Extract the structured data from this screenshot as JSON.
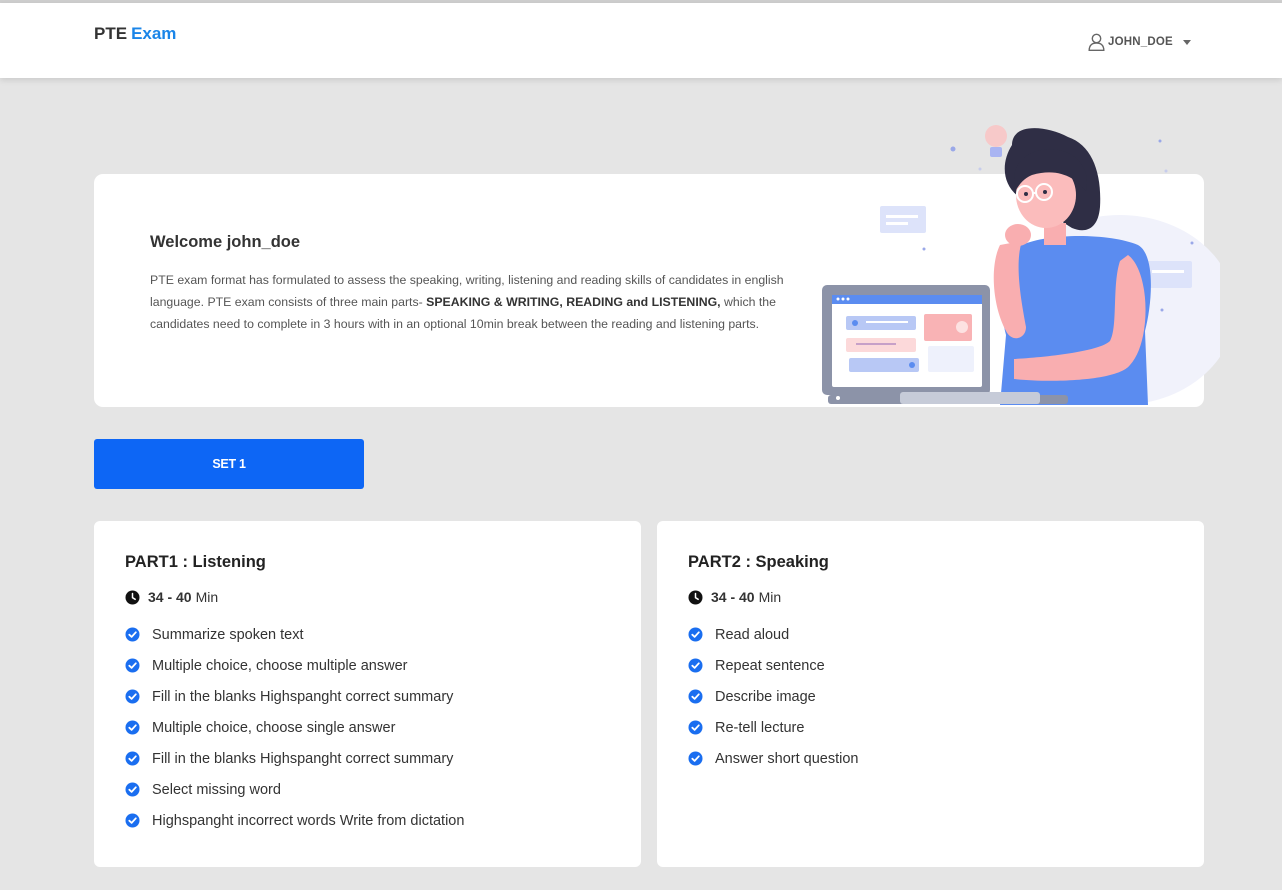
{
  "navbar": {
    "brand_main": "PTE",
    "brand_accent": "Exam",
    "username": "JOHN_DOE",
    "user_icon": "user-icon"
  },
  "welcome": {
    "title": "Welcome john_doe",
    "text_before": "PTE exam format has formulated to assess the speaking, writing, listening and reading skills of candidates in english language. PTE exam consists of three main parts- ",
    "text_bold": "SPEAKING & WRITING, READING and LISTENING,",
    "text_after": " which the candidates need to complete in 3 hours with in an optional 10min break between the reading and listening parts."
  },
  "set_button": {
    "label": "SET 1"
  },
  "parts": [
    {
      "title": "PART1 : Listening",
      "duration_range": "34 - 40",
      "duration_unit": "Min",
      "tasks": [
        "Summarize spoken text",
        "Multiple choice, choose multiple answer",
        "Fill in the blanks Highspanght correct summary",
        "Multiple choice, choose single answer",
        "Fill in the blanks Highspanght correct summary",
        "Select missing word",
        "Highspanght incorrect words Write from dictation"
      ]
    },
    {
      "title": "PART2 : Speaking",
      "duration_range": "34 - 40",
      "duration_unit": "Min",
      "tasks": [
        "Read aloud",
        "Repeat sentence",
        "Describe image",
        "Re-tell lecture",
        "Answer short question"
      ]
    }
  ],
  "colors": {
    "accent": "#1a85e8",
    "button": "#0d66f5",
    "check": "#1a6ef0",
    "background": "#e5e5e5"
  }
}
